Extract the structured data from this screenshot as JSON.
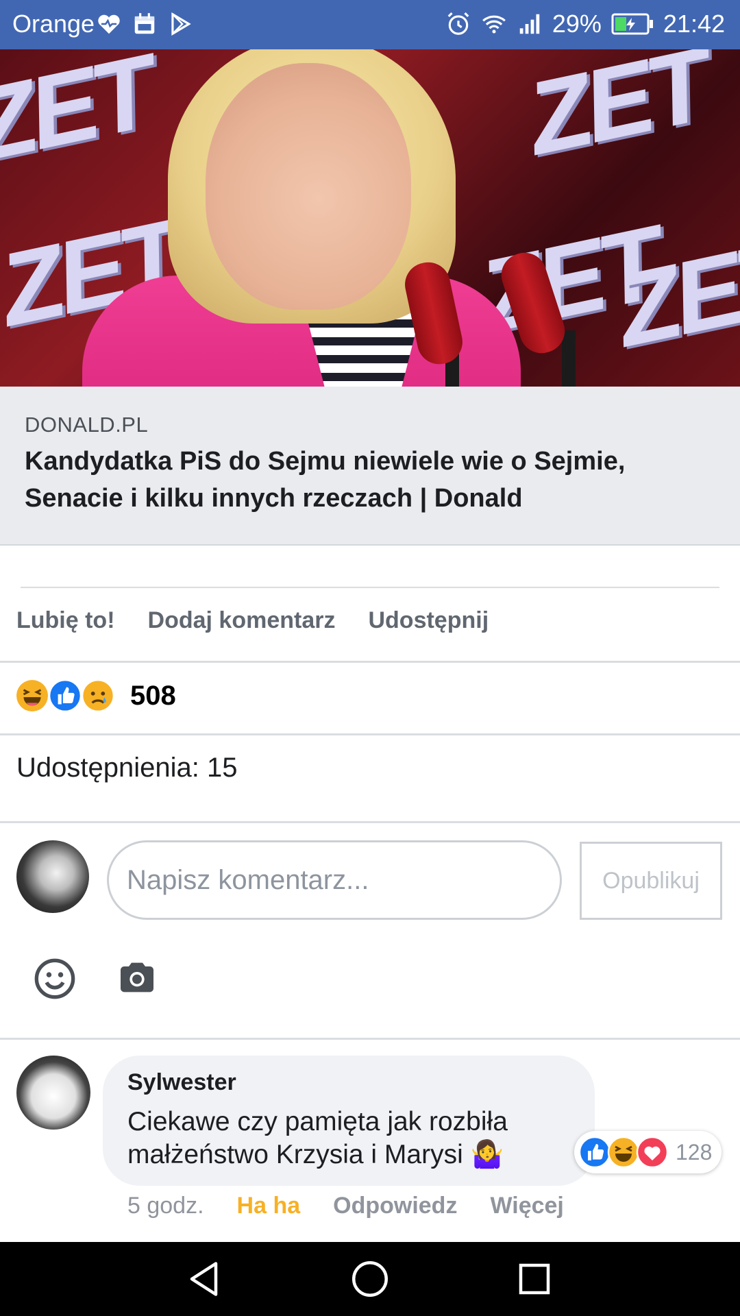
{
  "status_bar": {
    "carrier": "Orange",
    "battery": "29%",
    "time": "21:42",
    "icons": [
      "heart-monitor-icon",
      "calendar-icon",
      "play-store-icon",
      "alarm-icon",
      "wifi-icon",
      "signal-icon",
      "battery-icon"
    ]
  },
  "hero": {
    "brand_mark": "ZET"
  },
  "link_preview": {
    "domain": "DONALD.PL",
    "title": "Kandydatka PiS do Sejmu niewiele wie o Sejmie, Senacie i kilku innych rzeczach | Donald"
  },
  "actions": {
    "like": "Lubię to!",
    "comment": "Dodaj komentarz",
    "share": "Udostępnij"
  },
  "reactions": {
    "icons": [
      "haha-reaction-icon",
      "like-reaction-icon",
      "sad-reaction-icon"
    ],
    "count": "508"
  },
  "shares": {
    "text": "Udostępnienia: 15"
  },
  "composer": {
    "placeholder": "Napisz komentarz...",
    "publish_label": "Opublikuj",
    "tools": [
      "emoji-icon",
      "camera-icon"
    ]
  },
  "comment": {
    "author": "Sylwester",
    "text": "Ciekawe czy pamięta jak rozbiła małżeństwo Krzysia i Marysi 🤷‍♀️",
    "reactions": [
      "like-reaction-icon",
      "haha-reaction-icon",
      "love-reaction-icon"
    ],
    "reaction_count": "128",
    "time": "5 godz.",
    "my_reaction": "Ha ha",
    "reply": "Odpowiedz",
    "more": "Więcej"
  },
  "colors": {
    "status_bar": "#4267b2",
    "link_card": "#e9ebee",
    "haha_yellow": "#f7b125",
    "like_blue": "#1877f2",
    "love_red": "#f33e58"
  }
}
